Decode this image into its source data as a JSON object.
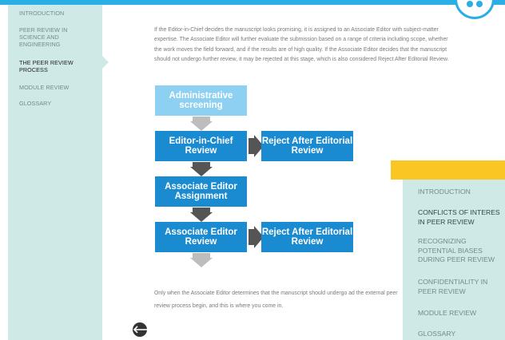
{
  "sidebar": {
    "items": [
      {
        "label": "INTRODUCTION"
      },
      {
        "label": "PEER REVIEW IN SCIENCE AND ENGINEERING"
      },
      {
        "label": "THE PEER REVIEW PROCESS"
      },
      {
        "label": "MODULE REVIEW"
      },
      {
        "label": "GLOSSARY"
      }
    ]
  },
  "content": {
    "intro": "If the Editor-in-Chief decides the manuscript looks promising, it is assigned to an Associate Editor with subject-matter expertise. The Associate Editor will further evaluate the submission based on a range of criteria including scope, whether the work moves the field forward, and if the results are of high quality. If the Associate Editor decides that the manuscript should not undergo further review, it may be rejected at this stage, which is also considered Reject After Editorial Review.",
    "bottom": "Only when the Associate Editor determines that the manuscript should undergo ad the external peer review process begin, and this is where you come in."
  },
  "flowchart": {
    "step1": "Administrative screening",
    "step2": "Editor-in-Chief Review",
    "reject1": "Reject After Editorial Review",
    "step3": "Associate Editor Assignment",
    "step4": "Associate Editor Review",
    "reject2": "Reject After Editorial Review"
  },
  "back_button": {
    "glyph": "🡐"
  },
  "overlay_menu": {
    "items": [
      {
        "label": "INTRODUCTION"
      },
      {
        "label": "CONFLICTS OF INTERES\nIN PEER REVIEW"
      },
      {
        "label": "RECOGNIZING\nPOTENTIAL BIASES\nDURING PEER REVIEW"
      },
      {
        "label": "CONFIDENTIALITY IN\nPEER REVIEW"
      },
      {
        "label": "MODULE REVIEW"
      },
      {
        "label": "GLOSSARY"
      }
    ]
  },
  "colors": {
    "accent": "#29aee6",
    "sidebar_bg": "#cfe9e6",
    "box_dark": "#1b8bd1",
    "box_light": "#8dd0f1",
    "highlight": "#f9c623"
  }
}
